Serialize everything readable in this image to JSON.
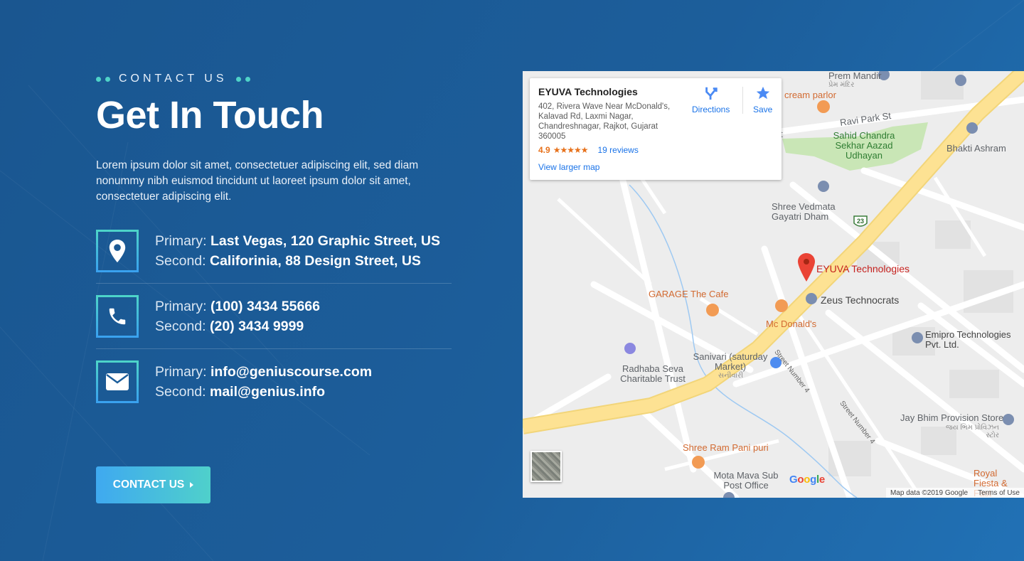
{
  "section": {
    "eyebrow": "CONTACT US",
    "title": "Get In Touch",
    "description": "Lorem ipsum dolor sit amet, consectetuer adipiscing elit, sed diam nonummy nibh euismod tincidunt ut laoreet ipsum dolor sit amet, consectetuer adipiscing elit."
  },
  "contacts": [
    {
      "icon": "location-pin-icon",
      "primary_label": "Primary:",
      "primary_value": "Last Vegas, 120 Graphic Street, US",
      "second_label": "Second:",
      "second_value": "Califorinia, 88 Design Street, US"
    },
    {
      "icon": "phone-icon",
      "primary_label": "Primary:",
      "primary_value": "(100) 3434 55666",
      "second_label": "Second:",
      "second_value": "(20) 3434 9999"
    },
    {
      "icon": "envelope-icon",
      "primary_label": "Primary:",
      "primary_value": "info@geniuscourse.com",
      "second_label": "Second:",
      "second_value": "mail@genius.info"
    }
  ],
  "cta": {
    "label": "CONTACT US"
  },
  "map": {
    "card": {
      "title": "EYUVA Technologies",
      "address": "402, Rivera Wave Near McDonald's, Kalavad Rd, Laxmi Nagar, Chandreshnagar, Rajkot, Gujarat 360005",
      "rating": "4.9",
      "stars": "★★★★★",
      "reviews": "19 reviews",
      "larger_map": "View larger map",
      "directions": "Directions",
      "save": "Save"
    },
    "places": {
      "prem_mandir": "Prem Mandir",
      "prem_mandir_local": "પ્રેમ મંદિર",
      "cream_parlor": "cream parlor",
      "ravi_park": "Ravi Park St",
      "sahid": "Sahid Chandra Sekhar Aazad Udhayan",
      "bhakti": "Bhakti Ashram",
      "shree_vedmata": "Shree Vedmata Gayatri Dham",
      "eyuva": "EYUVA Technologies",
      "garage": "GARAGE The Cafe",
      "zeus": "Zeus Technocrats",
      "mcd": "Mc Donald's",
      "emipro": "Emipro Technologies Pvt. Ltd.",
      "street4": "Street Number 4",
      "sanivari": "Sanivari (saturday Market)",
      "sanivari_local": "સનીવારી",
      "radhaba": "Radhaba Seva Charitable Trust",
      "jay_bhim": "Jay Bhim Provision Store",
      "jay_bhim_local": "જય ભિમ પ્રોવિઝન સ્ટોર",
      "shree_ram": "Shree Ram Pani puri",
      "mota_mava": "Mota Mava Sub Post Office",
      "royal": "Royal Fiesta & Fast",
      "route_23": "23",
      "partial_t": "t"
    },
    "google": "Google",
    "attribution": "Map data ©2019 Google",
    "terms": "Terms of Use"
  }
}
